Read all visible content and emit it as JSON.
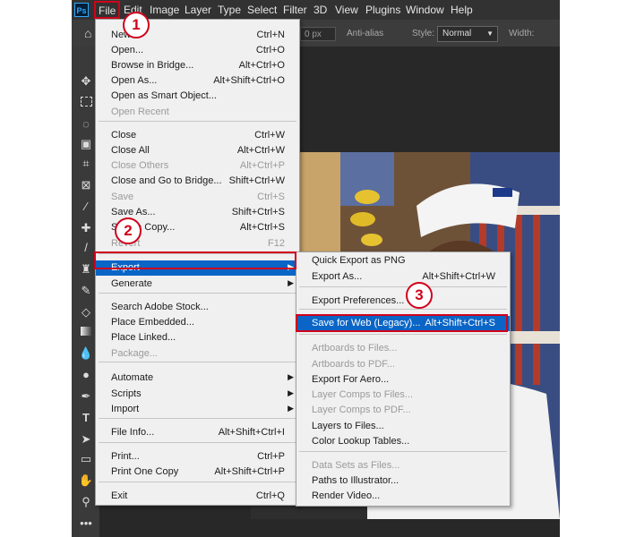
{
  "menubar": {
    "logo": "Ps",
    "items": [
      "File",
      "Edit",
      "Image",
      "Layer",
      "Type",
      "Select",
      "Filter",
      "3D",
      "View",
      "Plugins",
      "Window",
      "Help"
    ]
  },
  "options_bar": {
    "px_value": "0 px",
    "antialias": "Anti-alias",
    "style_label": "Style:",
    "style_value": "Normal",
    "width_label": "Width:"
  },
  "file_menu": {
    "items": [
      {
        "label": "New...",
        "shortcut": "Ctrl+N",
        "disabled": false
      },
      {
        "label": "Open...",
        "shortcut": "Ctrl+O",
        "disabled": false
      },
      {
        "label": "Browse in Bridge...",
        "shortcut": "Alt+Ctrl+O",
        "disabled": false
      },
      {
        "label": "Open As...",
        "shortcut": "Alt+Shift+Ctrl+O",
        "disabled": false
      },
      {
        "label": "Open as Smart Object...",
        "shortcut": "",
        "disabled": false
      },
      {
        "label": "Open Recent",
        "shortcut": "",
        "disabled": true
      },
      {
        "label": "Close",
        "shortcut": "Ctrl+W",
        "disabled": false
      },
      {
        "label": "Close All",
        "shortcut": "Alt+Ctrl+W",
        "disabled": false
      },
      {
        "label": "Close Others",
        "shortcut": "Alt+Ctrl+P",
        "disabled": true
      },
      {
        "label": "Close and Go to Bridge...",
        "shortcut": "Shift+Ctrl+W",
        "disabled": false
      },
      {
        "label": "Save",
        "shortcut": "Ctrl+S",
        "disabled": true
      },
      {
        "label": "Save As...",
        "shortcut": "Shift+Ctrl+S",
        "disabled": false
      },
      {
        "label": "Save a Copy...",
        "shortcut": "Alt+Ctrl+S",
        "disabled": false
      },
      {
        "label": "Revert",
        "shortcut": "F12",
        "disabled": true
      },
      {
        "label": "Export",
        "shortcut": "",
        "disabled": false
      },
      {
        "label": "Generate",
        "shortcut": "",
        "disabled": false
      },
      {
        "label": "Search Adobe Stock...",
        "shortcut": "",
        "disabled": false
      },
      {
        "label": "Place Embedded...",
        "shortcut": "",
        "disabled": false
      },
      {
        "label": "Place Linked...",
        "shortcut": "",
        "disabled": false
      },
      {
        "label": "Package...",
        "shortcut": "",
        "disabled": true
      },
      {
        "label": "Automate",
        "shortcut": "",
        "disabled": false
      },
      {
        "label": "Scripts",
        "shortcut": "",
        "disabled": false
      },
      {
        "label": "Import",
        "shortcut": "",
        "disabled": false
      },
      {
        "label": "File Info...",
        "shortcut": "Alt+Shift+Ctrl+I",
        "disabled": false
      },
      {
        "label": "Print...",
        "shortcut": "Ctrl+P",
        "disabled": false
      },
      {
        "label": "Print One Copy",
        "shortcut": "Alt+Shift+Ctrl+P",
        "disabled": false
      },
      {
        "label": "Exit",
        "shortcut": "Ctrl+Q",
        "disabled": false
      }
    ]
  },
  "export_menu": {
    "items": [
      {
        "label": "Quick Export as PNG",
        "shortcut": "",
        "disabled": false
      },
      {
        "label": "Export As...",
        "shortcut": "Alt+Shift+Ctrl+W",
        "disabled": false
      },
      {
        "label": "Export Preferences...",
        "shortcut": "",
        "disabled": false
      },
      {
        "label": "Save for Web (Legacy)...",
        "shortcut": "Alt+Shift+Ctrl+S",
        "disabled": false
      },
      {
        "label": "Artboards to Files...",
        "shortcut": "",
        "disabled": true
      },
      {
        "label": "Artboards to PDF...",
        "shortcut": "",
        "disabled": true
      },
      {
        "label": "Export For Aero...",
        "shortcut": "",
        "disabled": false
      },
      {
        "label": "Layer Comps to Files...",
        "shortcut": "",
        "disabled": true
      },
      {
        "label": "Layer Comps to PDF...",
        "shortcut": "",
        "disabled": true
      },
      {
        "label": "Layers to Files...",
        "shortcut": "",
        "disabled": false
      },
      {
        "label": "Color Lookup Tables...",
        "shortcut": "",
        "disabled": false
      },
      {
        "label": "Data Sets as Files...",
        "shortcut": "",
        "disabled": true
      },
      {
        "label": "Paths to Illustrator...",
        "shortcut": "",
        "disabled": false
      },
      {
        "label": "Render Video...",
        "shortcut": "",
        "disabled": false
      }
    ]
  },
  "steps": [
    "1",
    "2",
    "3"
  ],
  "colors": {
    "highlight": "#0a65c6",
    "annotation": "#d0021b",
    "menu_bg": "#f0f0f0"
  }
}
